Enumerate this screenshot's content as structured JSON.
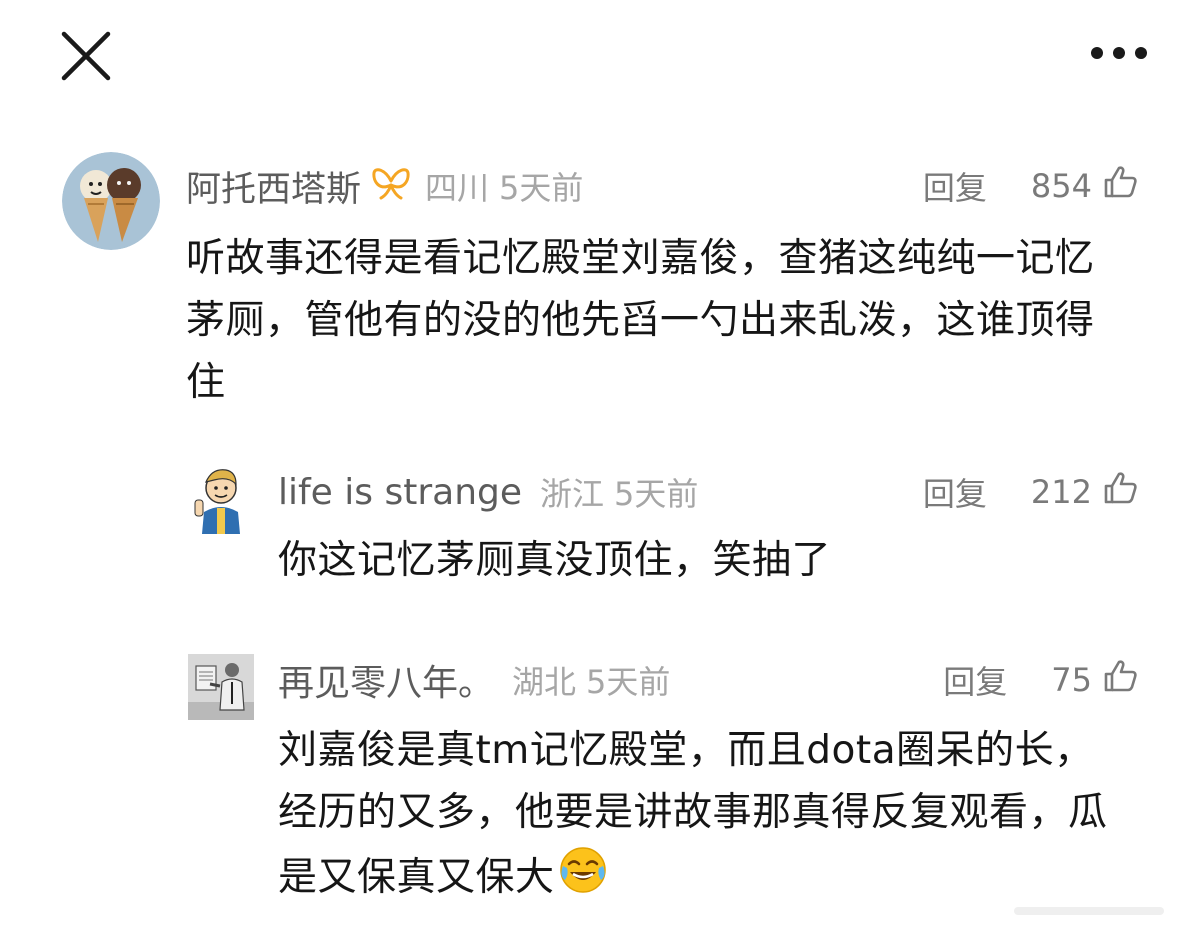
{
  "comments": [
    {
      "username": "阿托西塔斯",
      "location": "四川",
      "time": "5天前",
      "reply_label": "回复",
      "likes": "854",
      "text": "听故事还得是看记忆殿堂刘嘉俊，查猪这纯纯一记忆茅厕，管他有的没的他先舀一勺出来乱泼，这谁顶得住",
      "avatar": "ice-cream-avatar",
      "badge": "vip-badge-icon"
    },
    {
      "username": "life is strange",
      "location": "浙江",
      "time": "5天前",
      "reply_label": "回复",
      "likes": "212",
      "text": "你这记忆茅厕真没顶住，笑抽了",
      "avatar": "vault-boy-avatar"
    },
    {
      "username": "再见零八年。",
      "location": "湖北",
      "time": "5天前",
      "reply_label": "回复",
      "likes": "75",
      "text": "刘嘉俊是真tm记忆殿堂，而且dota圈呆的长，经历的又多，他要是讲故事那真得反复观看，瓜是又保真又保大",
      "avatar": "photo-avatar",
      "emoji": "tears-of-joy"
    }
  ],
  "icons": {
    "close": "close-icon",
    "more": "more-icon",
    "like": "thumbs-up-icon"
  },
  "colors": {
    "username": "#5c5c5c",
    "meta": "#a6a6a6",
    "action": "#7a7a7a",
    "text": "#161616",
    "badge": "#f5a623"
  }
}
